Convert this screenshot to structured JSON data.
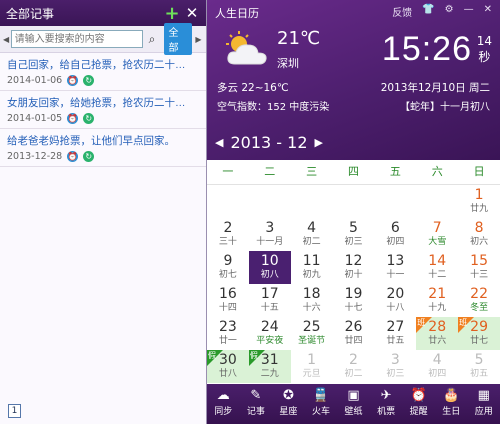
{
  "memo": {
    "title": "全部记事",
    "add_symbol": "+",
    "close_symbol": "✕",
    "search_placeholder": "请输入要搜索的内容",
    "filter_label": "全部",
    "items": [
      {
        "text": "自己回家，给自己抢票，抢农历二十…",
        "date": "2014-01-06"
      },
      {
        "text": "女朋友回家，给她抢票，抢农历二十…",
        "date": "2014-01-05"
      },
      {
        "text": "给老爸老妈抢票，让他们早点回家。",
        "date": "2013-12-28"
      }
    ],
    "page": "1"
  },
  "header": {
    "app_title": "人生日历",
    "controls": [
      "反馈",
      "👕",
      "⚙",
      "—",
      "✕"
    ],
    "temperature": "21℃",
    "city": "深圳",
    "time": "15:26",
    "seconds": "14",
    "seconds_label": "秒",
    "weather_range": "多云 22~16℃",
    "aqi": "空气指数：152 中度污染",
    "date": "2013年12月10日 周二",
    "lunar": "【蛇年】十一月初八",
    "nav_month": "2013 - 12"
  },
  "weekdays": [
    "一",
    "二",
    "三",
    "四",
    "五",
    "六",
    "日"
  ],
  "weeks": [
    [
      {
        "n": "",
        "s": ""
      },
      {
        "n": "",
        "s": ""
      },
      {
        "n": "",
        "s": ""
      },
      {
        "n": "",
        "s": ""
      },
      {
        "n": "",
        "s": ""
      },
      {
        "n": "",
        "s": ""
      },
      {
        "n": "1",
        "s": "廿九",
        "t": "wend"
      }
    ],
    [
      {
        "n": "2",
        "s": "三十"
      },
      {
        "n": "3",
        "s": "十一月"
      },
      {
        "n": "4",
        "s": "初二"
      },
      {
        "n": "5",
        "s": "初三"
      },
      {
        "n": "6",
        "s": "初四"
      },
      {
        "n": "7",
        "s": "大雪",
        "t": "wend special"
      },
      {
        "n": "8",
        "s": "初六",
        "t": "wend"
      }
    ],
    [
      {
        "n": "9",
        "s": "初七"
      },
      {
        "n": "10",
        "s": "初八",
        "t": "today"
      },
      {
        "n": "11",
        "s": "初九"
      },
      {
        "n": "12",
        "s": "初十"
      },
      {
        "n": "13",
        "s": "十一"
      },
      {
        "n": "14",
        "s": "十二",
        "t": "wend"
      },
      {
        "n": "15",
        "s": "十三",
        "t": "wend"
      }
    ],
    [
      {
        "n": "16",
        "s": "十四"
      },
      {
        "n": "17",
        "s": "十五"
      },
      {
        "n": "18",
        "s": "十六"
      },
      {
        "n": "19",
        "s": "十七"
      },
      {
        "n": "20",
        "s": "十八"
      },
      {
        "n": "21",
        "s": "十九",
        "t": "wend"
      },
      {
        "n": "22",
        "s": "冬至",
        "t": "wend special"
      }
    ],
    [
      {
        "n": "23",
        "s": "廿一"
      },
      {
        "n": "24",
        "s": "平安夜",
        "t": "special"
      },
      {
        "n": "25",
        "s": "圣诞节",
        "t": "special"
      },
      {
        "n": "26",
        "s": "廿四"
      },
      {
        "n": "27",
        "s": "廿五"
      },
      {
        "n": "28",
        "s": "廿六",
        "t": "wend hol",
        "tag": "ban"
      },
      {
        "n": "29",
        "s": "廿七",
        "t": "wend hol",
        "tag": "ban"
      }
    ],
    [
      {
        "n": "30",
        "s": "廿八",
        "t": "hol",
        "tag": "jia"
      },
      {
        "n": "31",
        "s": "二九",
        "t": "hol",
        "tag": "jia"
      },
      {
        "n": "1",
        "s": "元旦",
        "t": "other"
      },
      {
        "n": "2",
        "s": "初二",
        "t": "other"
      },
      {
        "n": "3",
        "s": "初三",
        "t": "other"
      },
      {
        "n": "4",
        "s": "初四",
        "t": "other"
      },
      {
        "n": "5",
        "s": "初五",
        "t": "other"
      }
    ]
  ],
  "tag_labels": {
    "ban": "班",
    "jia": "假"
  },
  "toolbar": [
    {
      "icon": "☁",
      "label": "同步",
      "name": "sync"
    },
    {
      "icon": "✎",
      "label": "记事",
      "name": "memo"
    },
    {
      "icon": "✪",
      "label": "星座",
      "name": "horoscope"
    },
    {
      "icon": "🚆",
      "label": "火车",
      "name": "train"
    },
    {
      "icon": "▣",
      "label": "壁纸",
      "name": "wallpaper"
    },
    {
      "icon": "✈",
      "label": "机票",
      "name": "flight"
    },
    {
      "icon": "⏰",
      "label": "提醒",
      "name": "reminder"
    },
    {
      "icon": "🎂",
      "label": "生日",
      "name": "birthday"
    },
    {
      "icon": "▦",
      "label": "应用",
      "name": "apps"
    }
  ]
}
